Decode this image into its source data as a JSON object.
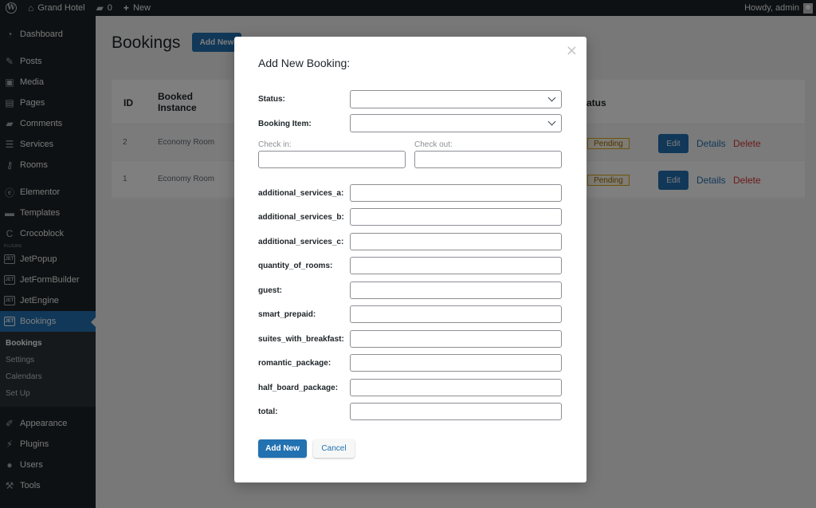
{
  "admin_bar": {
    "site_name": "Grand Hotel",
    "comments_count": "0",
    "new_label": "New",
    "greeting": "Howdy, admin"
  },
  "sidebar": {
    "items": [
      {
        "label": "Dashboard",
        "icon": "dashboard-icon"
      },
      {
        "label": "Posts",
        "icon": "pin-icon"
      },
      {
        "label": "Media",
        "icon": "media-icon"
      },
      {
        "label": "Pages",
        "icon": "pages-icon"
      },
      {
        "label": "Comments",
        "icon": "comment-icon"
      },
      {
        "label": "Services",
        "icon": "list-icon"
      },
      {
        "label": "Rooms",
        "icon": "key-icon"
      },
      {
        "label": "Elementor",
        "icon": "elementor-icon"
      },
      {
        "label": "Templates",
        "icon": "folder-icon"
      },
      {
        "label": "Crocoblock",
        "icon": "crocoblock-icon"
      },
      {
        "label": "JetPopup",
        "icon": "jet-icon"
      },
      {
        "label": "JetFormBuilder",
        "icon": "jet-icon"
      },
      {
        "label": "JetEngine",
        "icon": "jet-icon"
      },
      {
        "label": "Bookings",
        "icon": "jet-icon"
      },
      {
        "label": "Appearance",
        "icon": "brush-icon"
      },
      {
        "label": "Plugins",
        "icon": "plugin-icon"
      },
      {
        "label": "Users",
        "icon": "user-icon"
      },
      {
        "label": "Tools",
        "icon": "wrench-icon"
      }
    ],
    "plugins_label": "PLUGINS",
    "submenu": [
      "Bookings",
      "Settings",
      "Calendars",
      "Set Up"
    ]
  },
  "page": {
    "title": "Bookings",
    "add_new": "Add New"
  },
  "table": {
    "headers": {
      "id": "ID",
      "booked_instance_line1": "Booked",
      "booked_instance_line2": "Instance",
      "status": "atus"
    },
    "rows": [
      {
        "id": "2",
        "instance": "Economy Room",
        "status": "Pending",
        "edit": "Edit",
        "details": "Details",
        "delete": "Delete"
      },
      {
        "id": "1",
        "instance": "Economy Room",
        "status": "Pending",
        "edit": "Edit",
        "details": "Details",
        "delete": "Delete"
      }
    ]
  },
  "modal": {
    "title": "Add New Booking:",
    "close": "×",
    "status_label": "Status:",
    "booking_item_label": "Booking Item:",
    "check_in_label": "Check in:",
    "check_out_label": "Check out:",
    "fields": [
      "additional_services_a:",
      "additional_services_b:",
      "additional_services_c:",
      "quantity_of_rooms:",
      "guest:",
      "smart_prepaid:",
      "suites_with_breakfast:",
      "romantic_package:",
      "half_board_package:",
      "total:"
    ],
    "add_button": "Add New",
    "cancel_button": "Cancel"
  },
  "colors": {
    "admin_dark": "#1d2327",
    "accent": "#2271b1",
    "danger": "#d63638"
  }
}
